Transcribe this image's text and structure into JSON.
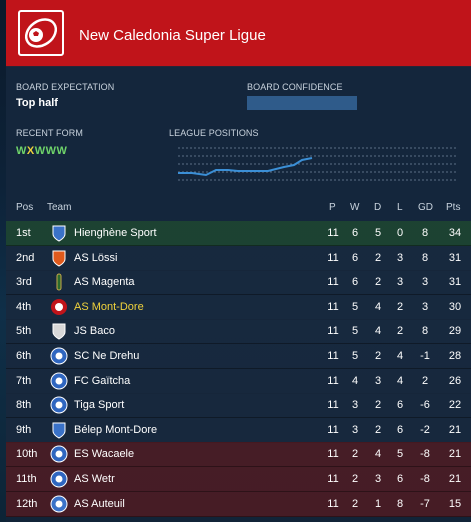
{
  "header": {
    "title": "New Caledonia Super Ligue",
    "accent": "#c0141a",
    "icon": "football-icon"
  },
  "board": {
    "expectation_label": "BOARD EXPECTATION",
    "expectation_value": "Top half",
    "confidence_label": "BOARD CONFIDENCE"
  },
  "recent_form": {
    "label": "RECENT FORM",
    "results": [
      "W",
      "X",
      "W",
      "W",
      "W"
    ]
  },
  "league_positions": {
    "label": "LEAGUE POSITIONS"
  },
  "table": {
    "headers": {
      "pos": "Pos",
      "team": "Team",
      "p": "P",
      "w": "W",
      "d": "D",
      "l": "L",
      "gd": "GD",
      "pts": "Pts"
    },
    "rows": [
      {
        "pos": "1st",
        "team": "Hienghène Sport",
        "p": "11",
        "w": "6",
        "d": "5",
        "l": "0",
        "gd": "8",
        "pts": "34",
        "crest": "shield-icon"
      },
      {
        "pos": "2nd",
        "team": "AS Lössi",
        "p": "11",
        "w": "6",
        "d": "2",
        "l": "3",
        "gd": "8",
        "pts": "31",
        "crest": "shield-icon"
      },
      {
        "pos": "3rd",
        "team": "AS Magenta",
        "p": "11",
        "w": "6",
        "d": "2",
        "l": "3",
        "gd": "3",
        "pts": "31",
        "crest": "bottle-icon"
      },
      {
        "pos": "4th",
        "team": "AS Mont-Dore",
        "p": "11",
        "w": "5",
        "d": "4",
        "l": "2",
        "gd": "3",
        "pts": "30",
        "crest": "ball-icon"
      },
      {
        "pos": "5th",
        "team": "JS Baco",
        "p": "11",
        "w": "5",
        "d": "4",
        "l": "2",
        "gd": "8",
        "pts": "29",
        "crest": "shield-icon"
      },
      {
        "pos": "6th",
        "team": "SC Ne Drehu",
        "p": "11",
        "w": "5",
        "d": "2",
        "l": "4",
        "gd": "-1",
        "pts": "28",
        "crest": "round-crest-icon"
      },
      {
        "pos": "7th",
        "team": "FC Gaïtcha",
        "p": "11",
        "w": "4",
        "d": "3",
        "l": "4",
        "gd": "2",
        "pts": "26",
        "crest": "round-crest-icon"
      },
      {
        "pos": "8th",
        "team": "Tiga Sport",
        "p": "11",
        "w": "3",
        "d": "2",
        "l": "6",
        "gd": "-6",
        "pts": "22",
        "crest": "round-crest-icon"
      },
      {
        "pos": "9th",
        "team": "Bélep Mont-Dore",
        "p": "11",
        "w": "3",
        "d": "2",
        "l": "6",
        "gd": "-2",
        "pts": "21",
        "crest": "shield-icon"
      },
      {
        "pos": "10th",
        "team": "ES Wacaele",
        "p": "11",
        "w": "2",
        "d": "4",
        "l": "5",
        "gd": "-8",
        "pts": "21",
        "crest": "round-crest-icon"
      },
      {
        "pos": "11th",
        "team": "AS Wetr",
        "p": "11",
        "w": "2",
        "d": "3",
        "l": "6",
        "gd": "-8",
        "pts": "21",
        "crest": "round-crest-icon"
      },
      {
        "pos": "12th",
        "team": "AS Auteuil",
        "p": "11",
        "w": "2",
        "d": "1",
        "l": "8",
        "gd": "-7",
        "pts": "15",
        "crest": "round-crest-icon"
      }
    ]
  },
  "colors": {
    "win": "#6fd36a",
    "draw": "#f0d23c",
    "highlight_team": "#f0d23c",
    "chart_line": "#3b8fd6"
  }
}
